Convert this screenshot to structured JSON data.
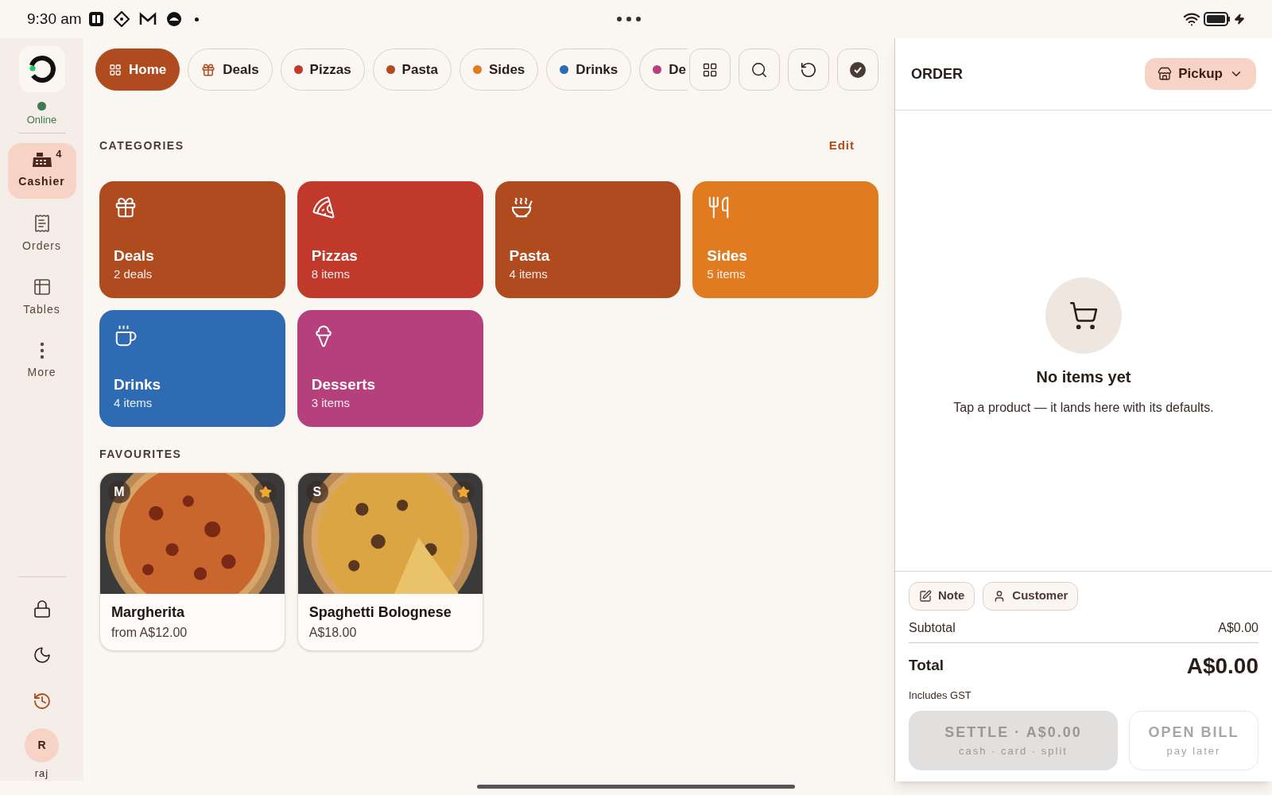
{
  "status_bar": {
    "time": "9:30 am"
  },
  "sidebar": {
    "status": "Online",
    "online": true,
    "items": [
      {
        "kind": "cashier",
        "label": "Cashier",
        "badge": "4",
        "selected": true
      },
      {
        "kind": "orders",
        "label": "Orders",
        "selected": false
      },
      {
        "kind": "tables",
        "label": "Tables",
        "selected": false
      },
      {
        "kind": "more",
        "label": "More",
        "selected": false
      }
    ],
    "user": {
      "initial": "R",
      "name": "raj"
    }
  },
  "tabs": [
    {
      "kind": "home",
      "label": "Home",
      "selected": true
    },
    {
      "kind": "deals",
      "label": "Deals",
      "selected": false
    },
    {
      "kind": "category",
      "label": "Pizzas",
      "color": "#c0392b",
      "selected": false
    },
    {
      "kind": "category",
      "label": "Pasta",
      "color": "#b04a1f",
      "selected": false
    },
    {
      "kind": "category",
      "label": "Sides",
      "color": "#e07b1f",
      "selected": false
    },
    {
      "kind": "category",
      "label": "Drinks",
      "color": "#2e6bb3",
      "selected": false
    },
    {
      "kind": "category",
      "label": "De",
      "color": "#b5407d",
      "selected": false
    }
  ],
  "categories": {
    "title": "CATEGORIES",
    "edit": "Edit",
    "items": [
      {
        "kind": "gift",
        "name": "Deals",
        "count": "2 deals",
        "color": "#b04a1f"
      },
      {
        "kind": "pizza",
        "name": "Pizzas",
        "count": "8 items",
        "color": "#c0392b"
      },
      {
        "kind": "bowl",
        "name": "Pasta",
        "count": "4 items",
        "color": "#b04a1f"
      },
      {
        "kind": "utensils",
        "name": "Sides",
        "count": "5 items",
        "color": "#e07b1f"
      },
      {
        "kind": "cup",
        "name": "Drinks",
        "count": "4 items",
        "color": "#2e6bb3"
      },
      {
        "kind": "icecream",
        "name": "Desserts",
        "count": "3 items",
        "color": "#b5407d"
      }
    ]
  },
  "favourites": {
    "title": "FAVOURITES",
    "items": [
      {
        "badge": "M",
        "name": "Margherita",
        "price": "from A$12.00",
        "starred": true
      },
      {
        "badge": "S",
        "name": "Spaghetti Bolognese",
        "price": "A$18.00",
        "starred": true
      }
    ]
  },
  "order": {
    "title": "ORDER",
    "mode": "Pickup",
    "empty_title": "No items yet",
    "empty_text": "Tap a product — it lands here with its defaults.",
    "note": "Note",
    "customer": "Customer",
    "subtotal_label": "Subtotal",
    "subtotal": "A$0.00",
    "total_label": "Total",
    "total": "A$0.00",
    "tax_note": "Includes GST",
    "settle": {
      "label": "SETTLE · A$0.00",
      "sub": "cash · card · split",
      "disabled": true
    },
    "open_bill": {
      "label": "OPEN BILL",
      "sub": "pay later",
      "disabled": true
    }
  }
}
